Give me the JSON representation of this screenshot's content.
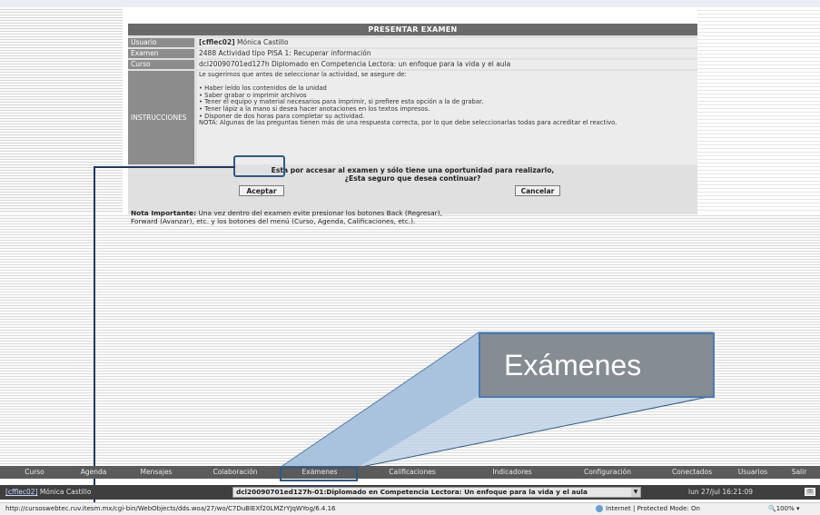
{
  "exam": {
    "title": "PRESENTAR EXAMEN",
    "usuario_label": "Usuario",
    "usuario_value_bold": "[cfflec02]",
    "usuario_value_name": "Mónica Castillo",
    "examen_label": "Examen",
    "examen_value": "2488 Actividad tipo PISA 1: Recuperar información",
    "curso_label": "Curso",
    "curso_value": "dcl20090701ed127h Diplomado en Competencia Lectora: un enfoque para la vida y el aula",
    "instrucciones_label": "INSTRUCCIONES",
    "instrucciones_text": "Le sugerimos que antes de seleccionar la actividad, se asegure de:\n\n• Haber leído los contenidos de la unidad\n• Saber grabar o imprimir archivos\n• Tener el equipo y material necesarios para imprimir, si prefiere esta opción a la de grabar.\n• Tener lápiz a la mano si desea hacer anotaciones en los textos impresos.\n• Disponer de dos horas para completar su actividad.\nNOTA: Algunas de las preguntas tienen más de una respuesta correcta, por lo que debe seleccionarlas todas para acreditar el reactivo.",
    "warning_line1": "Esta por accesar al examen y sólo tiene una oportunidad para realizarlo,",
    "warning_line2": "¿Esta seguro que desea continuar?",
    "accept_label": "Aceptar",
    "cancel_label": "Cancelar",
    "note_bold": "Nota Importante:",
    "note_text": " Una vez dentro del examen evite presionar los botones Back (Regresar),",
    "note_text2": "Forward (Avanzar), etc. y los botones del menú (Curso, Agenda, Calificaciones, etc.)."
  },
  "callout": {
    "label": "Exámenes"
  },
  "menu": {
    "items": [
      "Curso",
      "Agenda",
      "Mensajes",
      "Colaboración",
      "Exámenes",
      "Calificaciones",
      "Indicadores",
      "Configuración",
      "Conectados",
      "Usuarios",
      "Salir"
    ]
  },
  "session": {
    "user_bracket": "[cfflec02]",
    "user_name": "Mónica Castillo",
    "course_select": "dcl20090701ed127h-01:Diplomado en Competencia Lectora: Un enfoque para la vida y el aula",
    "datetime": "lun 27/jul 16:21:09"
  },
  "status": {
    "url": "http://cursoswebtec.ruv.itesm.mx/cgi-bin/WebObjects/dds.woa/27/wo/C7DuBlEXf20LMZrYJqWYog/6.4.16",
    "zone": "Internet | Protected Mode: On",
    "zoom": "100%"
  },
  "colors": {
    "panel_header": "#6a6a6a",
    "label_bg": "#8c8c8c",
    "highlight_border": "#2d5a87",
    "callout_bg": "#858c92",
    "beam_fill": "#b9cfe6"
  }
}
